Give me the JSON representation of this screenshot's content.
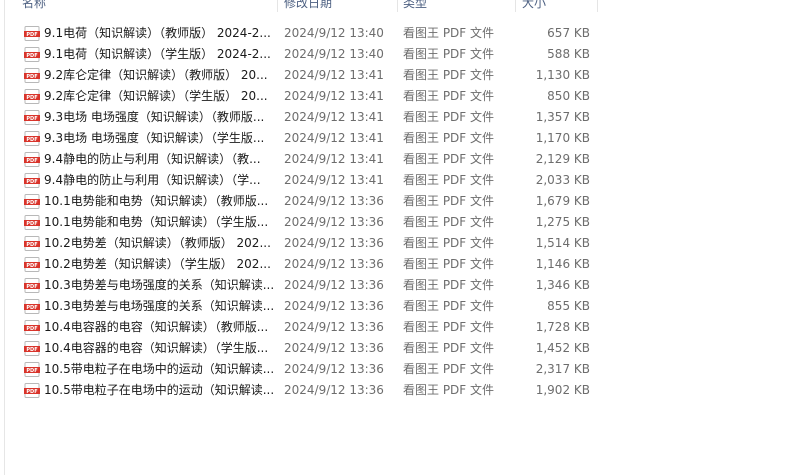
{
  "columns": {
    "name": "名称",
    "date": "修改日期",
    "type": "类型",
    "size": "大小"
  },
  "icon": "pdf-file-icon",
  "accent_color": "#d9342b",
  "files": [
    {
      "name": "9.1电荷（知识解读）（教师版） 2024-2...",
      "date": "2024/9/12 13:40",
      "type": "看图王 PDF 文件",
      "size": "657 KB"
    },
    {
      "name": "9.1电荷（知识解读）（学生版） 2024-2...",
      "date": "2024/9/12 13:40",
      "type": "看图王 PDF 文件",
      "size": "588 KB"
    },
    {
      "name": "9.2库仑定律（知识解读）（教师版） 20...",
      "date": "2024/9/12 13:41",
      "type": "看图王 PDF 文件",
      "size": "1,130 KB"
    },
    {
      "name": "9.2库仑定律（知识解读）（学生版） 20...",
      "date": "2024/9/12 13:41",
      "type": "看图王 PDF 文件",
      "size": "850 KB"
    },
    {
      "name": "9.3电场 电场强度（知识解读）（教师版...",
      "date": "2024/9/12 13:41",
      "type": "看图王 PDF 文件",
      "size": "1,357 KB"
    },
    {
      "name": "9.3电场 电场强度（知识解读）（学生版...",
      "date": "2024/9/12 13:41",
      "type": "看图王 PDF 文件",
      "size": "1,170 KB"
    },
    {
      "name": "9.4静电的防止与利用（知识解读）（教...",
      "date": "2024/9/12 13:41",
      "type": "看图王 PDF 文件",
      "size": "2,129 KB"
    },
    {
      "name": "9.4静电的防止与利用（知识解读）（学...",
      "date": "2024/9/12 13:41",
      "type": "看图王 PDF 文件",
      "size": "2,033 KB"
    },
    {
      "name": "10.1电势能和电势（知识解读）（教师版...",
      "date": "2024/9/12 13:36",
      "type": "看图王 PDF 文件",
      "size": "1,679 KB"
    },
    {
      "name": "10.1电势能和电势（知识解读）（学生版...",
      "date": "2024/9/12 13:36",
      "type": "看图王 PDF 文件",
      "size": "1,275 KB"
    },
    {
      "name": "10.2电势差（知识解读）（教师版） 202...",
      "date": "2024/9/12 13:36",
      "type": "看图王 PDF 文件",
      "size": "1,514 KB"
    },
    {
      "name": "10.2电势差（知识解读）（学生版） 202...",
      "date": "2024/9/12 13:36",
      "type": "看图王 PDF 文件",
      "size": "1,146 KB"
    },
    {
      "name": "10.3电势差与电场强度的关系（知识解读...",
      "date": "2024/9/12 13:36",
      "type": "看图王 PDF 文件",
      "size": "1,346 KB"
    },
    {
      "name": "10.3电势差与电场强度的关系（知识解读...",
      "date": "2024/9/12 13:36",
      "type": "看图王 PDF 文件",
      "size": "855 KB"
    },
    {
      "name": "10.4电容器的电容（知识解读）（教师版...",
      "date": "2024/9/12 13:36",
      "type": "看图王 PDF 文件",
      "size": "1,728 KB"
    },
    {
      "name": "10.4电容器的电容（知识解读）（学生版...",
      "date": "2024/9/12 13:36",
      "type": "看图王 PDF 文件",
      "size": "1,452 KB"
    },
    {
      "name": "10.5带电粒子在电场中的运动（知识解读...",
      "date": "2024/9/12 13:36",
      "type": "看图王 PDF 文件",
      "size": "2,317 KB"
    },
    {
      "name": "10.5带电粒子在电场中的运动（知识解读...",
      "date": "2024/9/12 13:36",
      "type": "看图王 PDF 文件",
      "size": "1,902 KB"
    }
  ]
}
